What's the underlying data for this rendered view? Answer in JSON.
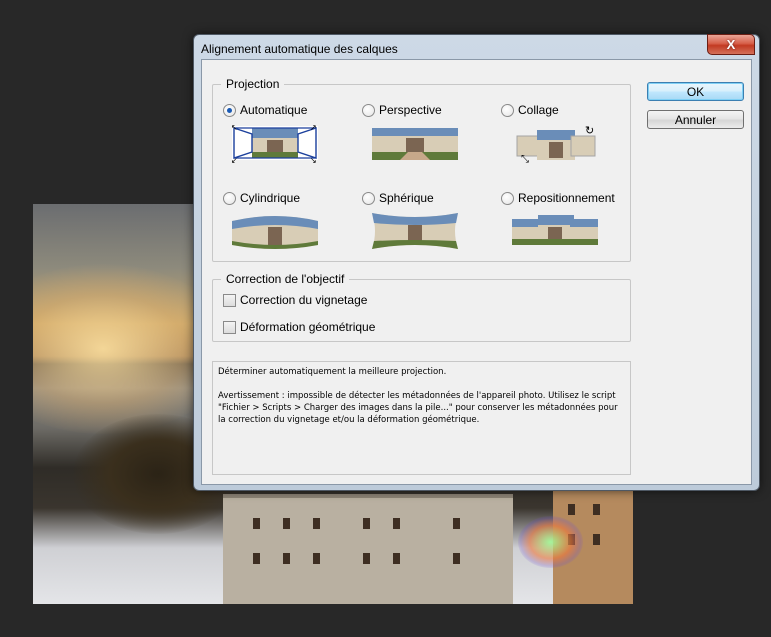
{
  "dialog": {
    "title": "Alignement automatique des calques",
    "close_label": "X"
  },
  "projection": {
    "legend": "Projection",
    "options": [
      {
        "label": "Automatique",
        "selected": true,
        "icon": "auto-projection-icon"
      },
      {
        "label": "Perspective",
        "selected": false,
        "icon": "perspective-projection-icon"
      },
      {
        "label": "Collage",
        "selected": false,
        "icon": "collage-projection-icon"
      },
      {
        "label": "Cylindrique",
        "selected": false,
        "icon": "cylindrical-projection-icon"
      },
      {
        "label": "Sphérique",
        "selected": false,
        "icon": "spherical-projection-icon"
      },
      {
        "label": "Repositionnement",
        "selected": false,
        "icon": "reposition-projection-icon"
      }
    ]
  },
  "lens": {
    "legend": "Correction de l'objectif",
    "vignette_label": "Correction du vignetage",
    "vignette_checked": false,
    "distortion_label": "Déformation géométrique",
    "distortion_checked": false
  },
  "buttons": {
    "ok": "OK",
    "cancel": "Annuler"
  },
  "info": {
    "line1": "Déterminer automatiquement la meilleure projection.",
    "line2": "Avertissement : impossible de détecter les métadonnées de l'appareil photo. Utilisez le script \"Fichier > Scripts > Charger des images dans la pile...\" pour conserver les métadonnées pour la correction du vignetage et/ou la déformation géométrique."
  }
}
